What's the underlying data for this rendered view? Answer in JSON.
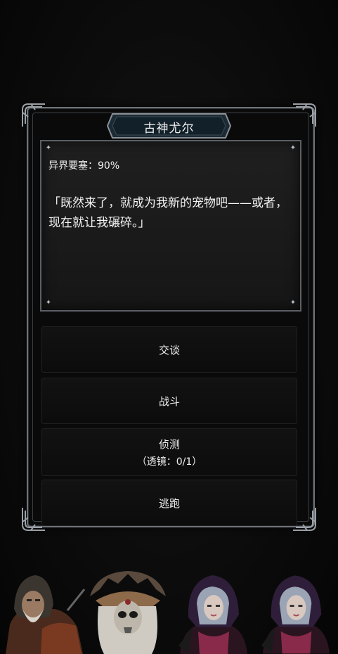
{
  "event": {
    "title": "古神尤尔",
    "location_line": "异界要塞：90%",
    "dialog_text": "「既然来了，就成为我新的宠物吧——或者，现在就让我碾碎。」"
  },
  "choices": [
    {
      "label": "交谈",
      "sub": ""
    },
    {
      "label": "战斗",
      "sub": ""
    },
    {
      "label": "侦测",
      "sub": "（透镜：0/1）"
    },
    {
      "label": "逃跑",
      "sub": ""
    }
  ],
  "party": [
    {
      "icon": "hooded-warrior-portrait"
    },
    {
      "icon": "skull-shaman-portrait"
    },
    {
      "icon": "hooded-sorceress-portrait"
    },
    {
      "icon": "hooded-sorceress-portrait"
    }
  ],
  "colors": {
    "background": "#0c0c0c",
    "frame": "#6e7378",
    "panel": "#1c1c1c",
    "button": "#101010",
    "text": "#f0f0f0"
  }
}
